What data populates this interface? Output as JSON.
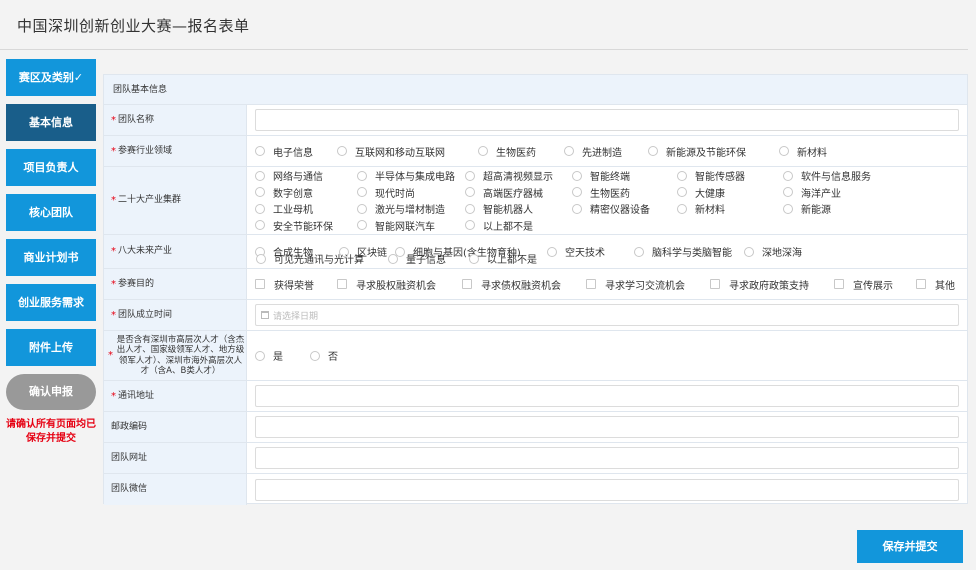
{
  "page_title": "中国深圳创新创业大赛—报名表单",
  "sidebar": {
    "items": [
      {
        "label": "赛区及类别✓",
        "active": false
      },
      {
        "label": "基本信息",
        "active": true
      },
      {
        "label": "项目负责人",
        "active": false
      },
      {
        "label": "核心团队",
        "active": false
      },
      {
        "label": "商业计划书",
        "active": false
      },
      {
        "label": "创业服务需求",
        "active": false
      },
      {
        "label": "附件上传",
        "active": false
      }
    ],
    "confirm_label": "确认申报",
    "notice": "请确认所有页面均已保存并提交"
  },
  "form": {
    "section_title": "团队基本信息",
    "team_name": {
      "label": "团队名称",
      "required": true,
      "value": ""
    },
    "industry": {
      "label": "参赛行业领域",
      "required": true,
      "options": [
        "电子信息",
        "互联网和移动互联网",
        "生物医药",
        "先进制造",
        "新能源及节能环保",
        "新材料"
      ]
    },
    "clusters": {
      "label": "二十大产业集群",
      "required": true,
      "options": [
        "网络与通信",
        "半导体与集成电路",
        "超高清视频显示",
        "智能终端",
        "智能传感器",
        "软件与信息服务",
        "数字创意",
        "现代时尚",
        "高端医疗器械",
        "生物医药",
        "大健康",
        "海洋产业",
        "工业母机",
        "激光与增材制造",
        "智能机器人",
        "精密仪器设备",
        "新材料",
        "新能源",
        "安全节能环保",
        "智能网联汽车",
        "以上都不是"
      ]
    },
    "future": {
      "label": "八大未来产业",
      "required": true,
      "options": [
        "合成生物",
        "区块链",
        "细胞与基因(含生物育种)",
        "空天技术",
        "脑科学与类脑智能",
        "深地深海",
        "可见光通讯与光计算",
        "量子信息",
        "以上都不是"
      ]
    },
    "purpose": {
      "label": "参赛目的",
      "required": true,
      "options": [
        "获得荣誉",
        "寻求股权融资机会",
        "寻求债权融资机会",
        "寻求学习交流机会",
        "寻求政府政策支持",
        "宣传展示",
        "其他"
      ]
    },
    "founded": {
      "label": "团队成立时间",
      "required": true,
      "placeholder": "请选择日期"
    },
    "talent": {
      "label": "是否含有深圳市高层次人才（含杰出人才、国家级领军人才、地方级领军人才）、深圳市海外高层次人才（含A、B类人才）",
      "required": true,
      "options": [
        "是",
        "否"
      ]
    },
    "address": {
      "label": "通讯地址",
      "required": true,
      "value": ""
    },
    "postcode": {
      "label": "邮政编码",
      "required": false,
      "value": ""
    },
    "website": {
      "label": "团队网址",
      "required": false,
      "value": ""
    },
    "wechat": {
      "label": "团队微信",
      "required": false,
      "value": ""
    }
  },
  "save_label": "保存并提交",
  "colors": {
    "primary": "#1296db",
    "active": "#195e8a",
    "label_bg": "#ecf3fb",
    "required": "#e60012"
  }
}
